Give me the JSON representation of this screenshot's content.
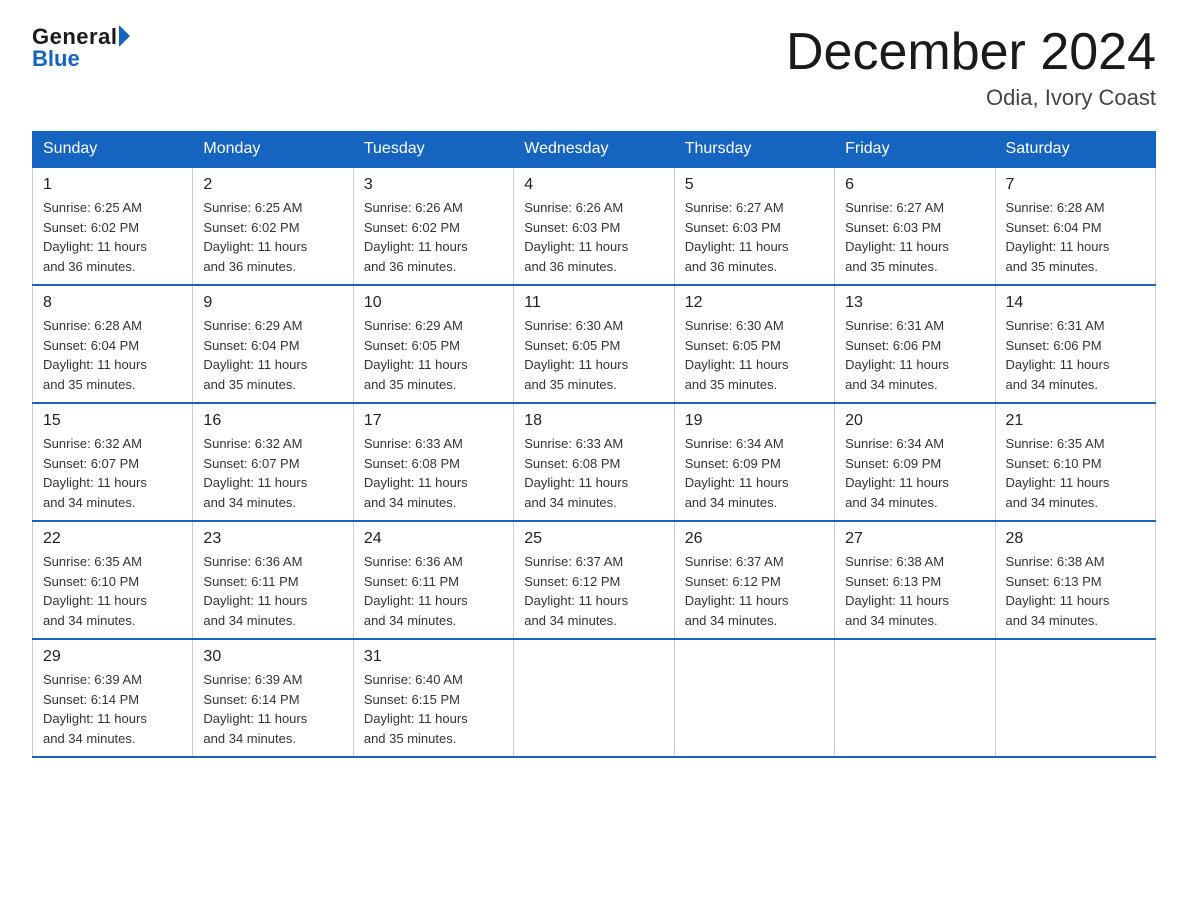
{
  "logo": {
    "general": "General",
    "blue": "Blue"
  },
  "title": "December 2024",
  "location": "Odia, Ivory Coast",
  "days_of_week": [
    "Sunday",
    "Monday",
    "Tuesday",
    "Wednesday",
    "Thursday",
    "Friday",
    "Saturday"
  ],
  "weeks": [
    [
      {
        "num": "1",
        "sunrise": "6:25 AM",
        "sunset": "6:02 PM",
        "daylight": "11 hours and 36 minutes."
      },
      {
        "num": "2",
        "sunrise": "6:25 AM",
        "sunset": "6:02 PM",
        "daylight": "11 hours and 36 minutes."
      },
      {
        "num": "3",
        "sunrise": "6:26 AM",
        "sunset": "6:02 PM",
        "daylight": "11 hours and 36 minutes."
      },
      {
        "num": "4",
        "sunrise": "6:26 AM",
        "sunset": "6:03 PM",
        "daylight": "11 hours and 36 minutes."
      },
      {
        "num": "5",
        "sunrise": "6:27 AM",
        "sunset": "6:03 PM",
        "daylight": "11 hours and 36 minutes."
      },
      {
        "num": "6",
        "sunrise": "6:27 AM",
        "sunset": "6:03 PM",
        "daylight": "11 hours and 35 minutes."
      },
      {
        "num": "7",
        "sunrise": "6:28 AM",
        "sunset": "6:04 PM",
        "daylight": "11 hours and 35 minutes."
      }
    ],
    [
      {
        "num": "8",
        "sunrise": "6:28 AM",
        "sunset": "6:04 PM",
        "daylight": "11 hours and 35 minutes."
      },
      {
        "num": "9",
        "sunrise": "6:29 AM",
        "sunset": "6:04 PM",
        "daylight": "11 hours and 35 minutes."
      },
      {
        "num": "10",
        "sunrise": "6:29 AM",
        "sunset": "6:05 PM",
        "daylight": "11 hours and 35 minutes."
      },
      {
        "num": "11",
        "sunrise": "6:30 AM",
        "sunset": "6:05 PM",
        "daylight": "11 hours and 35 minutes."
      },
      {
        "num": "12",
        "sunrise": "6:30 AM",
        "sunset": "6:05 PM",
        "daylight": "11 hours and 35 minutes."
      },
      {
        "num": "13",
        "sunrise": "6:31 AM",
        "sunset": "6:06 PM",
        "daylight": "11 hours and 34 minutes."
      },
      {
        "num": "14",
        "sunrise": "6:31 AM",
        "sunset": "6:06 PM",
        "daylight": "11 hours and 34 minutes."
      }
    ],
    [
      {
        "num": "15",
        "sunrise": "6:32 AM",
        "sunset": "6:07 PM",
        "daylight": "11 hours and 34 minutes."
      },
      {
        "num": "16",
        "sunrise": "6:32 AM",
        "sunset": "6:07 PM",
        "daylight": "11 hours and 34 minutes."
      },
      {
        "num": "17",
        "sunrise": "6:33 AM",
        "sunset": "6:08 PM",
        "daylight": "11 hours and 34 minutes."
      },
      {
        "num": "18",
        "sunrise": "6:33 AM",
        "sunset": "6:08 PM",
        "daylight": "11 hours and 34 minutes."
      },
      {
        "num": "19",
        "sunrise": "6:34 AM",
        "sunset": "6:09 PM",
        "daylight": "11 hours and 34 minutes."
      },
      {
        "num": "20",
        "sunrise": "6:34 AM",
        "sunset": "6:09 PM",
        "daylight": "11 hours and 34 minutes."
      },
      {
        "num": "21",
        "sunrise": "6:35 AM",
        "sunset": "6:10 PM",
        "daylight": "11 hours and 34 minutes."
      }
    ],
    [
      {
        "num": "22",
        "sunrise": "6:35 AM",
        "sunset": "6:10 PM",
        "daylight": "11 hours and 34 minutes."
      },
      {
        "num": "23",
        "sunrise": "6:36 AM",
        "sunset": "6:11 PM",
        "daylight": "11 hours and 34 minutes."
      },
      {
        "num": "24",
        "sunrise": "6:36 AM",
        "sunset": "6:11 PM",
        "daylight": "11 hours and 34 minutes."
      },
      {
        "num": "25",
        "sunrise": "6:37 AM",
        "sunset": "6:12 PM",
        "daylight": "11 hours and 34 minutes."
      },
      {
        "num": "26",
        "sunrise": "6:37 AM",
        "sunset": "6:12 PM",
        "daylight": "11 hours and 34 minutes."
      },
      {
        "num": "27",
        "sunrise": "6:38 AM",
        "sunset": "6:13 PM",
        "daylight": "11 hours and 34 minutes."
      },
      {
        "num": "28",
        "sunrise": "6:38 AM",
        "sunset": "6:13 PM",
        "daylight": "11 hours and 34 minutes."
      }
    ],
    [
      {
        "num": "29",
        "sunrise": "6:39 AM",
        "sunset": "6:14 PM",
        "daylight": "11 hours and 34 minutes."
      },
      {
        "num": "30",
        "sunrise": "6:39 AM",
        "sunset": "6:14 PM",
        "daylight": "11 hours and 34 minutes."
      },
      {
        "num": "31",
        "sunrise": "6:40 AM",
        "sunset": "6:15 PM",
        "daylight": "11 hours and 35 minutes."
      },
      null,
      null,
      null,
      null
    ]
  ],
  "labels": {
    "sunrise": "Sunrise:",
    "sunset": "Sunset:",
    "daylight": "Daylight:"
  }
}
